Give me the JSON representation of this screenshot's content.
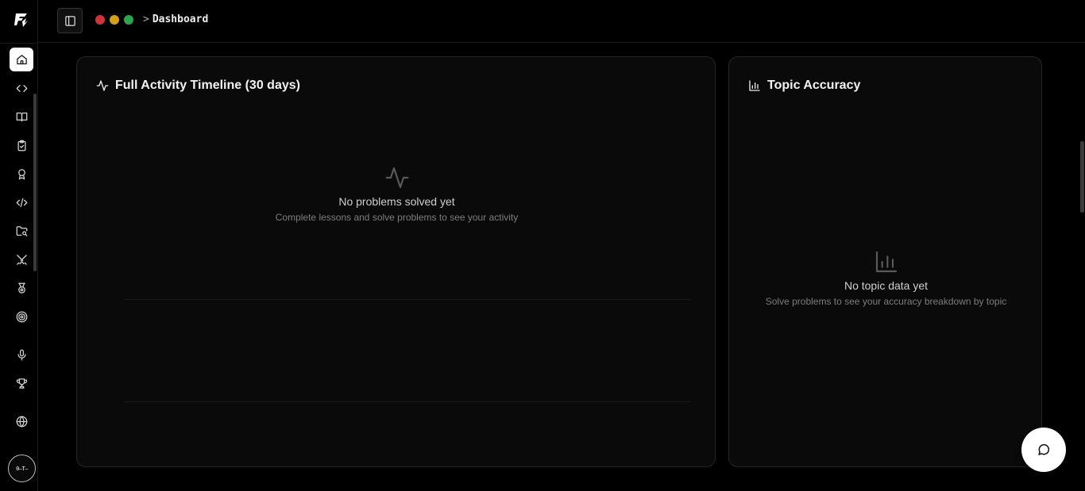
{
  "breadcrumb": {
    "separator": ">",
    "current": "Dashboard"
  },
  "window_dots": [
    "#d13438",
    "#d4a017",
    "#2da44e"
  ],
  "sidebar": {
    "items": [
      {
        "icon": "home-icon",
        "active": true
      },
      {
        "icon": "code-icon"
      },
      {
        "icon": "book-icon"
      },
      {
        "icon": "clipboard-check-icon"
      },
      {
        "icon": "award-icon"
      },
      {
        "icon": "code-slash-icon"
      },
      {
        "icon": "folder-search-icon"
      },
      {
        "icon": "swords-icon"
      },
      {
        "icon": "medal-icon"
      },
      {
        "icon": "target-icon"
      },
      {
        "icon": "mic-icon"
      },
      {
        "icon": "trophy-icon"
      },
      {
        "icon": "globe-icon"
      }
    ],
    "avatar_text": "0—T—"
  },
  "activity_card": {
    "title": "Full Activity Timeline (30 days)",
    "empty_title": "No problems solved yet",
    "empty_subtitle": "Complete lessons and solve problems to see your activity"
  },
  "topic_card": {
    "title": "Topic Accuracy",
    "empty_title": "No topic data yet",
    "empty_subtitle": "Solve problems to see your accuracy breakdown by topic"
  },
  "chat_button": {
    "icon": "message-circle-icon"
  }
}
